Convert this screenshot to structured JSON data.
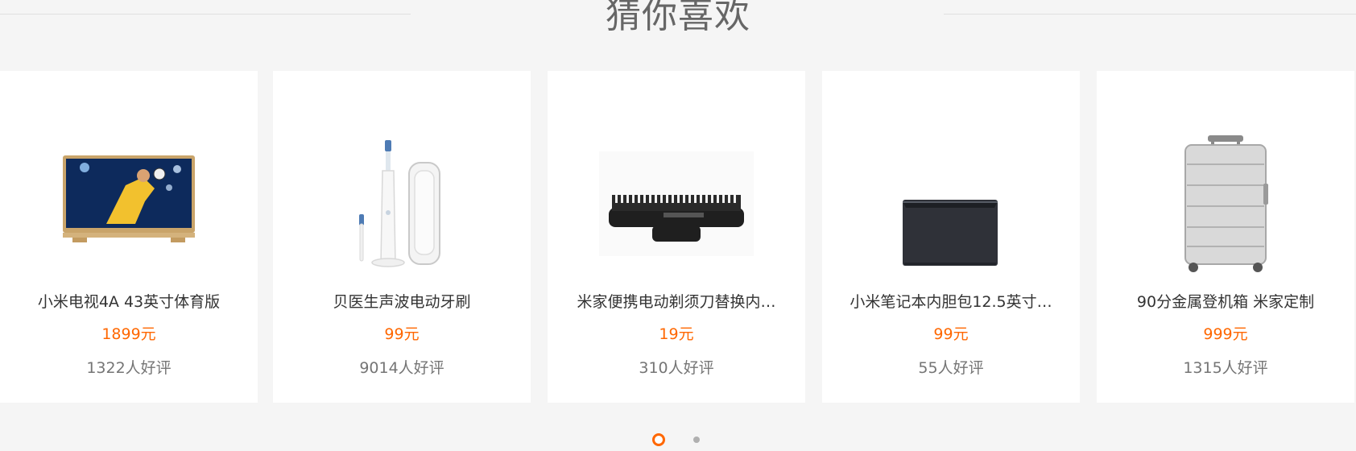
{
  "section": {
    "title": "猜你喜欢"
  },
  "products": [
    {
      "name": "小米电视4A 43英寸体育版",
      "price": "1899元",
      "reviews": "1322人好评",
      "image_icon": "tv-icon"
    },
    {
      "name": "贝医生声波电动牙刷",
      "price": "99元",
      "reviews": "9014人好评",
      "image_icon": "toothbrush-icon"
    },
    {
      "name": "米家便携电动剃须刀替换内…",
      "price": "19元",
      "reviews": "310人好评",
      "image_icon": "shaver-blade-icon"
    },
    {
      "name": "小米笔记本内胆包12.5英寸…",
      "price": "99元",
      "reviews": "55人好评",
      "image_icon": "laptop-sleeve-icon"
    },
    {
      "name": "90分金属登机箱 米家定制",
      "price": "999元",
      "reviews": "1315人好评",
      "image_icon": "suitcase-icon"
    }
  ],
  "pager": {
    "pages": 2,
    "current": 1
  },
  "colors": {
    "accent": "#ff6700",
    "background": "#f5f5f5",
    "card": "#ffffff",
    "title": "#666666",
    "name": "#333333",
    "reviews": "#757575"
  }
}
